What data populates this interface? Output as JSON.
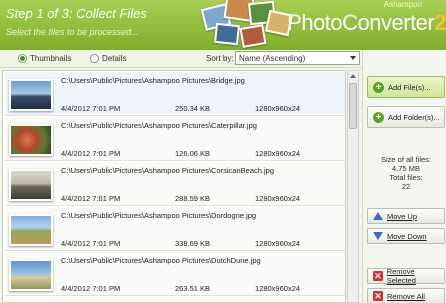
{
  "header": {
    "step_title": "Step 1 of 3: Collect Files",
    "step_subtitle": "Select the files to be processed...",
    "brand_small": "Ashampoo",
    "brand_name": "PhotoConverter",
    "brand_version": "2"
  },
  "toolbar": {
    "view_thumbnails": "Thumbnails",
    "view_details": "Details",
    "sort_label": "Sort by:",
    "sort_value": "Name (Ascending)"
  },
  "files": [
    {
      "path": "C:\\Users\\Public\\Pictures\\Ashampoo Pictures\\Bridge.jpg",
      "date": "4/4/2012 7:01 PM",
      "size": "250.34 KB",
      "dims": "1280x960x24"
    },
    {
      "path": "C:\\Users\\Public\\Pictures\\Ashampoo Pictures\\Caterpillar.jpg",
      "date": "4/4/2012 7:01 PM",
      "size": "126.06 KB",
      "dims": "1280x960x24"
    },
    {
      "path": "C:\\Users\\Public\\Pictures\\Ashampoo Pictures\\CorsicanBeach.jpg",
      "date": "4/4/2012 7:01 PM",
      "size": "288.59 KB",
      "dims": "1280x960x24"
    },
    {
      "path": "C:\\Users\\Public\\Pictures\\Ashampoo Pictures\\Dordogne.jpg",
      "date": "4/4/2012 7:01 PM",
      "size": "338.69 KB",
      "dims": "1280x960x24"
    },
    {
      "path": "C:\\Users\\Public\\Pictures\\Ashampoo Pictures\\DutchDune.jpg",
      "date": "4/4/2012 7:01 PM",
      "size": "263.51 KB",
      "dims": "1280x960x24"
    }
  ],
  "panel": {
    "add_files": "Add File(s)...",
    "add_folder": "Add Folder(s)...",
    "size_label": "Size of all files:",
    "size_value": "4.75 MB",
    "total_label": "Total files:",
    "total_value": "22",
    "move_up": "Move Up",
    "move_down": "Move Down",
    "remove_selected": "Remove Selected",
    "remove_all": "Remove All"
  },
  "icons": {
    "add_files": "plus-circle-icon",
    "add_folder": "plus-circle-icon",
    "move_up": "arrow-up-icon",
    "move_down": "arrow-down-icon",
    "remove": "x-icon"
  },
  "colors": {
    "accent_green": "#8fbc3a",
    "version_yellow": "#f7c22d"
  }
}
